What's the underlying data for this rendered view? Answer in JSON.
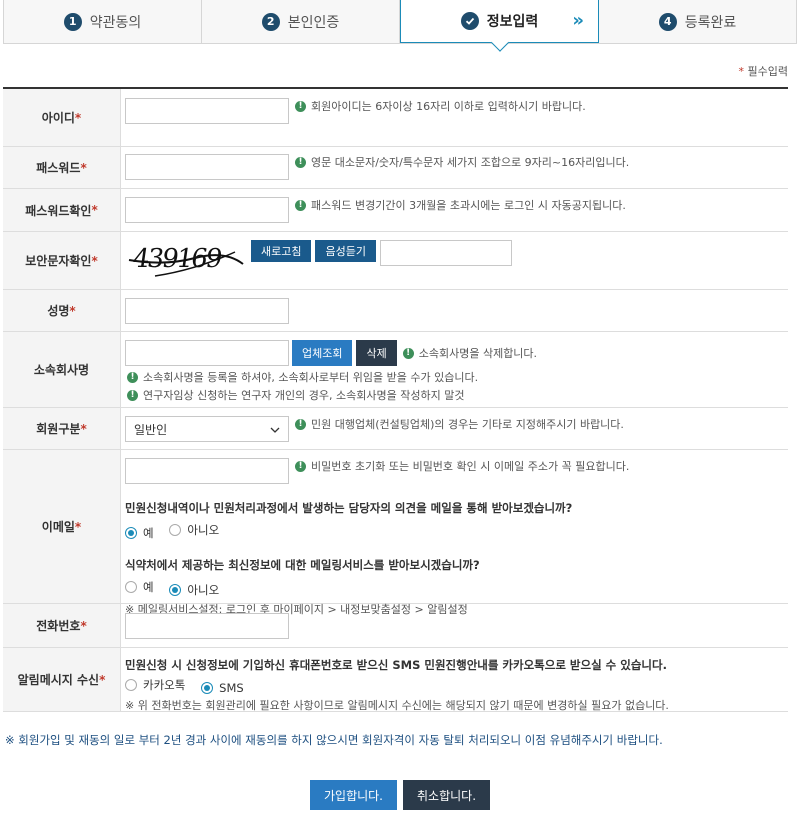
{
  "steps": [
    {
      "num": "1",
      "label": "약관동의"
    },
    {
      "num": "2",
      "label": "본인인증"
    },
    {
      "num": "",
      "label": "정보입력",
      "arrows": "»"
    },
    {
      "num": "4",
      "label": "등록완료"
    }
  ],
  "required_note": {
    "star": "*",
    "text": " 필수입력"
  },
  "star": "*",
  "fields": {
    "id": {
      "label": "아이디",
      "value": "",
      "hint": "회원아이디는 6자이상 16자리 이하로 입력하시기 바랍니다."
    },
    "password": {
      "label": "패스워드",
      "value": "",
      "hint": "영문 대소문자/숫자/특수문자 세가지 조합으로 9자리~16자리입니다."
    },
    "password_confirm": {
      "label": "패스워드확인",
      "value": "",
      "hint": "패스워드 변경기간이 3개월을 초과시에는 로그인 시 자동공지됩니다."
    },
    "captcha": {
      "label": "보안문자확인",
      "code": "439169",
      "refresh_label": "새로고침",
      "audio_label": "음성듣기",
      "value": ""
    },
    "name": {
      "label": "성명",
      "value": ""
    },
    "company": {
      "label": "소속회사명",
      "value": "",
      "search_label": "업체조회",
      "delete_label": "삭제",
      "hint1": "소속회사명을 삭제합니다.",
      "hint2": "소속회사명을 등록을 하셔야, 소속회사로부터 위임을 받을 수가 있습니다.",
      "hint3": "연구자임상 신청하는 연구자 개인의 경우, 소속회사명을 작성하지 말것"
    },
    "member_type": {
      "label": "회원구분",
      "selected": "일반인",
      "hint": "민원 대행업체(컨설팅업체)의 경우는 기타로 지정해주시기 바랍니다."
    },
    "email": {
      "label": "이메일",
      "value": "",
      "hint": "비밀번호 초기화 또는 비밀번호 확인 시 이메일 주소가 꼭 필요합니다.",
      "q1": "민원신청내역이나 민원처리과정에서 발생하는 담당자의 의견을 메일을 통해 받아보겠습니까?",
      "q1_yes": "예",
      "q1_no": "아니오",
      "q2": "식약처에서 제공하는 최신정보에 대한 메일링서비스를 받아보시겠습니까?",
      "q2_yes": "예",
      "q2_no": "아니오",
      "note": "※ 메일링서비스설정: 로그인 후 마이페이지 > 내정보맞춤설정 > 알림설정"
    },
    "phone": {
      "label": "전화번호",
      "value": ""
    },
    "notify": {
      "label": "알림메시지 수신",
      "question": "민원신청 시 신청정보에 기입하신 휴대폰번호로 받으신 SMS 민원진행안내를 카카오톡으로 받으실 수 있습니다.",
      "opt1": "카카오톡",
      "opt2": "SMS",
      "note": "※ 위 전화번호는 회원관리에 필요한 사항이므로 알림메시지 수신에는 해당되지 않기 때문에 변경하실 필요가 없습니다."
    }
  },
  "bottom_note": "※ 회원가입 및 재동의 일로 부터 2년 경과 사이에 재동의를 하지 않으시면 회원자격이 자동 탈퇴 처리되오니 이점 유념해주시기 바랍니다.",
  "actions": {
    "join": "가입합니다.",
    "cancel": "취소합니다."
  }
}
